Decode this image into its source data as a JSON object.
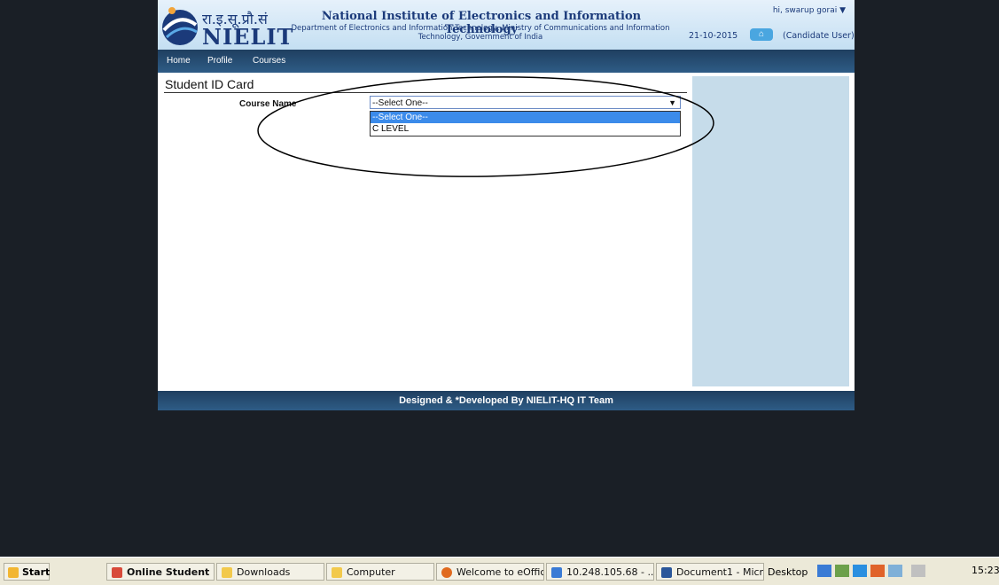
{
  "header": {
    "hindi_logo": "रा.इ.सू.प्रौ.सं",
    "logo_text": "NIELIT",
    "org_name": "National Institute of Electronics and Information Technology",
    "org_sub": "Department of Electronics and Information Technology, Ministry of Communications and Information Technology, Government of India",
    "greeting": "hi, swarup gorai ▼",
    "date": "21-10-2015",
    "user_type": "(Candidate User)"
  },
  "nav": {
    "items": [
      "Home",
      "Profile",
      "Courses"
    ]
  },
  "content": {
    "title": "Student ID Card",
    "course_label": "Course Name",
    "course_select_value": "--Select One--",
    "options": [
      "--Select One--",
      "C LEVEL"
    ]
  },
  "footer": {
    "text": "Designed & *Developed By NIELIT-HQ IT Team"
  },
  "taskbar": {
    "start": "start",
    "items": [
      "Online Student ...",
      "Downloads",
      "Computer",
      "Welcome to eOffic...",
      "10.248.105.68 - ...",
      "Document1 - Micr..."
    ],
    "desktop": "Desktop",
    "clock": "15:23"
  },
  "colors": {
    "nav_bg": "#1f3f60",
    "accent": "#3b8bea",
    "sidebar": "#c6dcea"
  }
}
